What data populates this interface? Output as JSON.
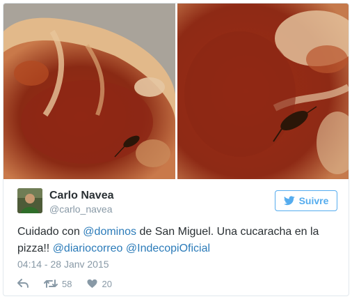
{
  "tweet": {
    "author": {
      "full_name": "Carlo Navea",
      "screen_name": "@carlo_navea",
      "avatar_icon": "user-avatar"
    },
    "follow_button": {
      "label": "Suivre",
      "icon": "twitter-bird-icon"
    },
    "text": {
      "p1": "Cuidado con ",
      "m1": "@dominos",
      "p2": " de San Miguel. Una cucaracha en la pizza!! ",
      "m2": "@diariocorreo",
      "p3": " ",
      "m3": "@IndecopiOficial"
    },
    "timestamp": "04:14 - 28 Janv 2015",
    "actions": {
      "reply_icon": "reply-icon",
      "retweet_icon": "retweet-icon",
      "retweet_count": "58",
      "like_icon": "heart-icon",
      "like_count": "20"
    },
    "photos": [
      "pizza-photo-1",
      "pizza-photo-2"
    ],
    "colors": {
      "link": "#2b7bb9",
      "twitter_blue": "#55acee",
      "muted": "#8899a6",
      "text": "#292f33"
    }
  }
}
